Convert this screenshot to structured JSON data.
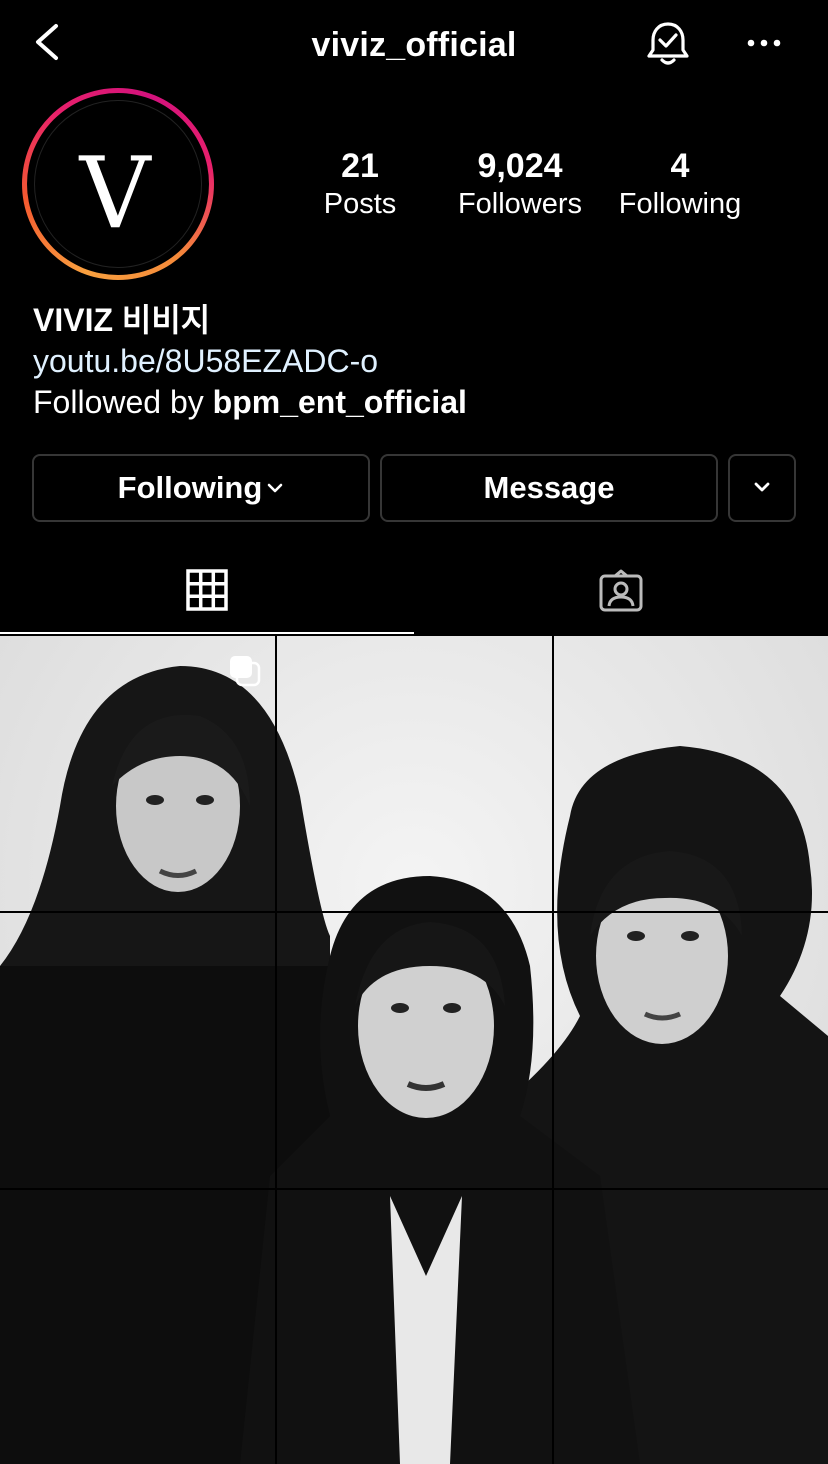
{
  "header": {
    "username": "viviz_official",
    "back_icon": "chevron-left-icon",
    "bell_icon": "bell-check-icon",
    "more_icon": "more-horizontal-icon"
  },
  "profile": {
    "avatar_letter": "V",
    "stats": [
      {
        "value": "21",
        "label": "Posts"
      },
      {
        "value": "9,024",
        "label": "Followers"
      },
      {
        "value": "4",
        "label": "Following"
      }
    ],
    "name": "VIVIZ 비비지",
    "link": "youtu.be/8U58EZADC-o",
    "followed_prefix": "Followed by ",
    "followed_user": "bpm_ent_official"
  },
  "actions": {
    "following_label": "Following",
    "message_label": "Message"
  },
  "tabs": [
    {
      "name": "posts-grid",
      "icon": "grid-icon",
      "active": true
    },
    {
      "name": "tagged",
      "icon": "tagged-person-icon",
      "active": false
    }
  ],
  "colors": {
    "background": "#000000",
    "link": "#e0f1ff",
    "button_border": "#363636",
    "ring_start": "#f9a03f",
    "ring_end": "#d3127d"
  }
}
